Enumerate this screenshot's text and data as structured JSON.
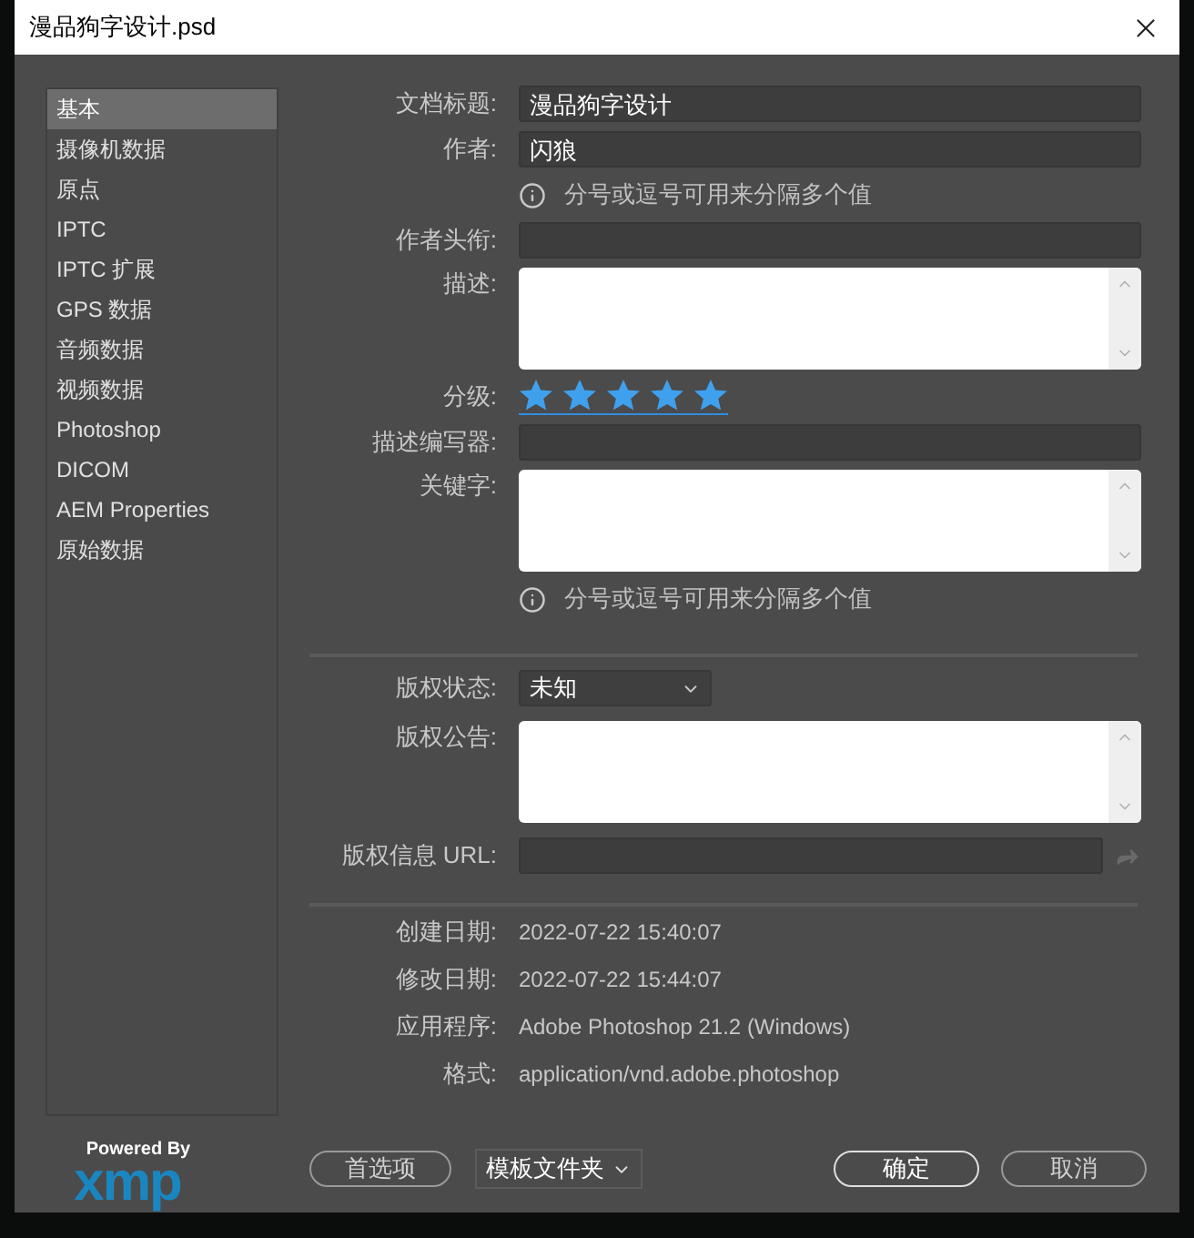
{
  "window": {
    "title": "漫品狗字设计.psd"
  },
  "sidebar": {
    "items": [
      {
        "label": "基本",
        "selected": true
      },
      {
        "label": "摄像机数据",
        "selected": false
      },
      {
        "label": "原点",
        "selected": false
      },
      {
        "label": "IPTC",
        "selected": false
      },
      {
        "label": "IPTC 扩展",
        "selected": false
      },
      {
        "label": "GPS 数据",
        "selected": false
      },
      {
        "label": "音频数据",
        "selected": false
      },
      {
        "label": "视频数据",
        "selected": false
      },
      {
        "label": "Photoshop",
        "selected": false
      },
      {
        "label": "DICOM",
        "selected": false
      },
      {
        "label": "AEM Properties",
        "selected": false
      },
      {
        "label": "原始数据",
        "selected": false
      }
    ]
  },
  "logo": {
    "caption": "Powered By",
    "wordmark": "xmp"
  },
  "basic_fields": [
    {
      "kind": "text",
      "label": "文档标题:",
      "value": "漫品狗字设计"
    },
    {
      "kind": "text",
      "label": "作者:",
      "value": "闪狼"
    },
    {
      "kind": "note",
      "text": "分号或逗号可用来分隔多个值"
    },
    {
      "kind": "text",
      "label": "作者头衔:"
    },
    {
      "kind": "textarea",
      "label": "描述:"
    },
    {
      "kind": "rating",
      "label": "分级:",
      "stars": 5
    },
    {
      "kind": "text",
      "label": "描述编写器:"
    },
    {
      "kind": "textarea",
      "label": "关键字:"
    },
    {
      "kind": "note",
      "text": "分号或逗号可用来分隔多个值"
    }
  ],
  "copyright_fields": [
    {
      "kind": "select",
      "label": "版权状态:",
      "value": "未知"
    },
    {
      "kind": "textarea",
      "label": "版权公告:"
    },
    {
      "kind": "url",
      "label": "版权信息 URL:"
    }
  ],
  "file_info": [
    {
      "label": "创建日期:",
      "value": "2022-07-22 15:40:07"
    },
    {
      "label": "修改日期:",
      "value": "2022-07-22 15:44:07"
    },
    {
      "label": "应用程序:",
      "value": "Adobe Photoshop 21.2 (Windows)"
    },
    {
      "label": "格式:",
      "value": "application/vnd.adobe.photoshop"
    }
  ],
  "buttons": {
    "preferences": "首选项",
    "template_folder": "模板文件夹",
    "ok": "确定",
    "cancel": "取消"
  }
}
